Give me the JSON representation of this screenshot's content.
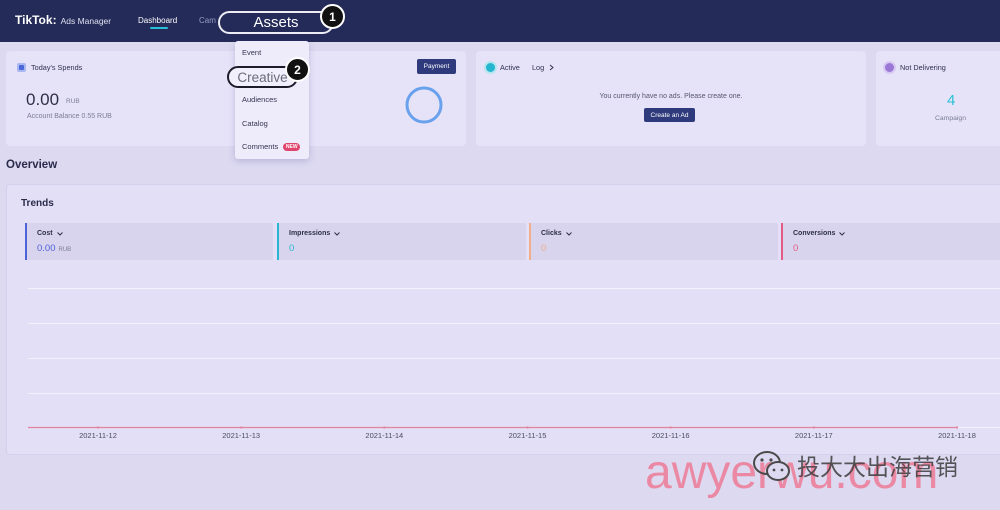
{
  "app": {
    "logo": "TikTok:",
    "product": "Ads Manager",
    "nav": [
      {
        "label": "Dashboard",
        "active": true
      },
      {
        "label": "Cam"
      },
      {
        "label": "Assets"
      }
    ]
  },
  "colors": {
    "topbar": "#242b59",
    "accent": "#27c0d6",
    "primary_button": "#2e3a7c",
    "page_background": "#dcd9f1"
  },
  "annotations": {
    "markers": [
      "1",
      "2"
    ]
  },
  "assets_menu": {
    "items": [
      {
        "label": "Event"
      },
      {
        "label": "Creative",
        "highlighted": true
      },
      {
        "label": "Audiences"
      },
      {
        "label": "Catalog"
      },
      {
        "label": "Comments",
        "badge": "NEW"
      }
    ]
  },
  "summary_cards": {
    "spends": {
      "icon": "spend-icon",
      "title": "Today's Spends",
      "value": "0.00",
      "unit": "RUB",
      "balance": "Account Balance 0.55 RUB",
      "payment_button": "Payment"
    },
    "active": {
      "icon": "active-status-icon",
      "title": "Active",
      "log_link": "Log",
      "empty_message": "You currently have no ads. Please create one.",
      "create_button": "Create an Ad"
    },
    "not_delivering": {
      "icon": "not-delivering-icon",
      "title": "Not Delivering",
      "count": "4",
      "count_label": "Campaign"
    }
  },
  "overview": {
    "heading": "Overview"
  },
  "trends": {
    "metrics": [
      {
        "label": "Cost",
        "value": "0.00",
        "unit": "RUB",
        "color": "#4f63d9"
      },
      {
        "label": "Impressions",
        "value": "0",
        "color": "#29b6d0"
      },
      {
        "label": "Clicks",
        "value": "0",
        "color": "#f2ad8a"
      },
      {
        "label": "Conversions",
        "value": "0",
        "color": "#e35b83"
      }
    ]
  },
  "chart_data": {
    "type": "line",
    "title": "Trends",
    "x": [
      "2021-11-12",
      "2021-11-13",
      "2021-11-14",
      "2021-11-15",
      "2021-11-16",
      "2021-11-17",
      "2021-11-18"
    ],
    "series": [
      {
        "values": [
          0,
          0,
          0,
          0,
          0,
          0,
          0
        ],
        "color": "#e4849c"
      }
    ],
    "grid": true
  },
  "watermark": {
    "icon": "wechat-icon",
    "brand": "投大大出海营销",
    "site": "awyerwu.com"
  }
}
